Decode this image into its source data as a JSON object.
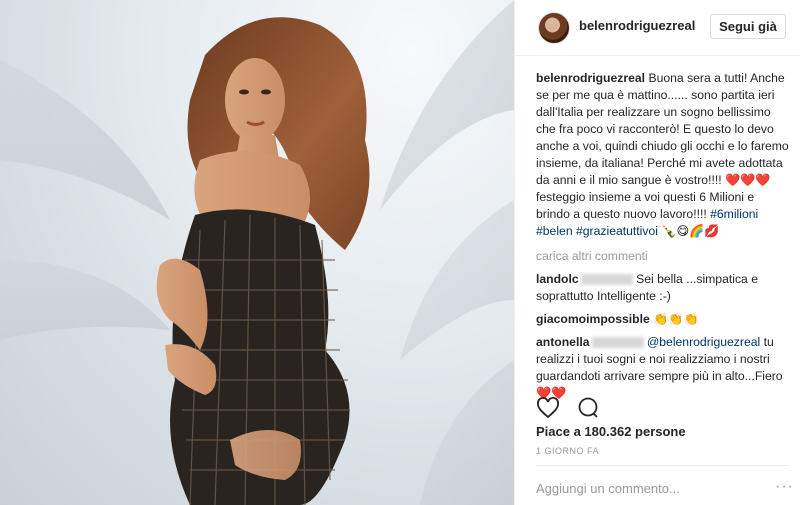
{
  "post": {
    "username": "belenrodriguezreal",
    "follow_label": "Segui già",
    "caption_user": "belenrodriguezreal",
    "caption_text": "Buona sera a tutti! Anche se per me qua è mattino...... sono partita ieri dall'Italia per realizzare un sogno bellissimo che fra poco vi racconterò! E questo lo devo anche a voi, quindi chiudo gli occhi e lo faremo insieme, da italiana! Perché mi avete adottata da anni e il mio sangue è vostro!!!! ❤️❤️❤️ festeggio insieme a voi questi 6 Milioni e brindo a questo nuovo lavoro!!!! ",
    "hashtags": [
      "#6milioni",
      "#belen",
      "#grazieatuttivoi"
    ],
    "caption_emoji": "🍾😋🌈💋",
    "load_more": "carica altri commenti",
    "comments": [
      {
        "user": "landolc",
        "text": "Sei bella ...simpatica e soprattutto Intelligente :-)"
      },
      {
        "user": "giacomoimpossible",
        "text": "👏👏👏"
      },
      {
        "user": "antonella",
        "mention": "@belenrodriguezreal",
        "text": "tu realizzi i tuoi sogni e noi realizziamo i nostri guardandoti arrivare sempre più in alto...Fiero❤️❤️"
      }
    ],
    "likes_label": "Piace a 180.362 persone",
    "time_label": "1 GIORNO FA",
    "add_comment_placeholder": "Aggiungi un commento...",
    "more_options": "···"
  },
  "icons": [
    "heart-icon",
    "comment-icon"
  ],
  "colors": {
    "link": "#003569",
    "muted": "#999999",
    "text": "#262626",
    "heart": "#e0245e"
  }
}
